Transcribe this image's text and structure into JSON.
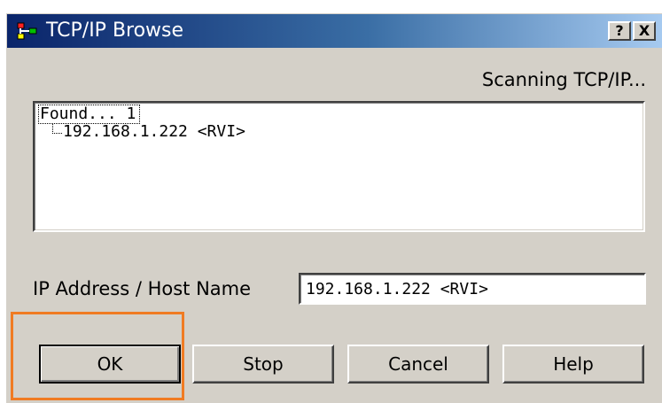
{
  "window": {
    "title": "TCP/IP Browse",
    "help_button": "?",
    "close_button": "X",
    "icon": "network-app-icon"
  },
  "status_text": "Scanning TCP/IP...",
  "tree": {
    "root_label": "Found... 1",
    "children": [
      "192.168.1.222 <RVI>"
    ]
  },
  "ip_field": {
    "label": "IP Address / Host Name",
    "value": "192.168.1.222 <RVI>"
  },
  "buttons": {
    "ok": "OK",
    "stop": "Stop",
    "cancel": "Cancel",
    "help": "Help"
  },
  "colors": {
    "highlight": "#f07b23",
    "titlebar_start": "#0a246a",
    "titlebar_end": "#a6caf0",
    "dialog_face": "#d4d0c8"
  }
}
